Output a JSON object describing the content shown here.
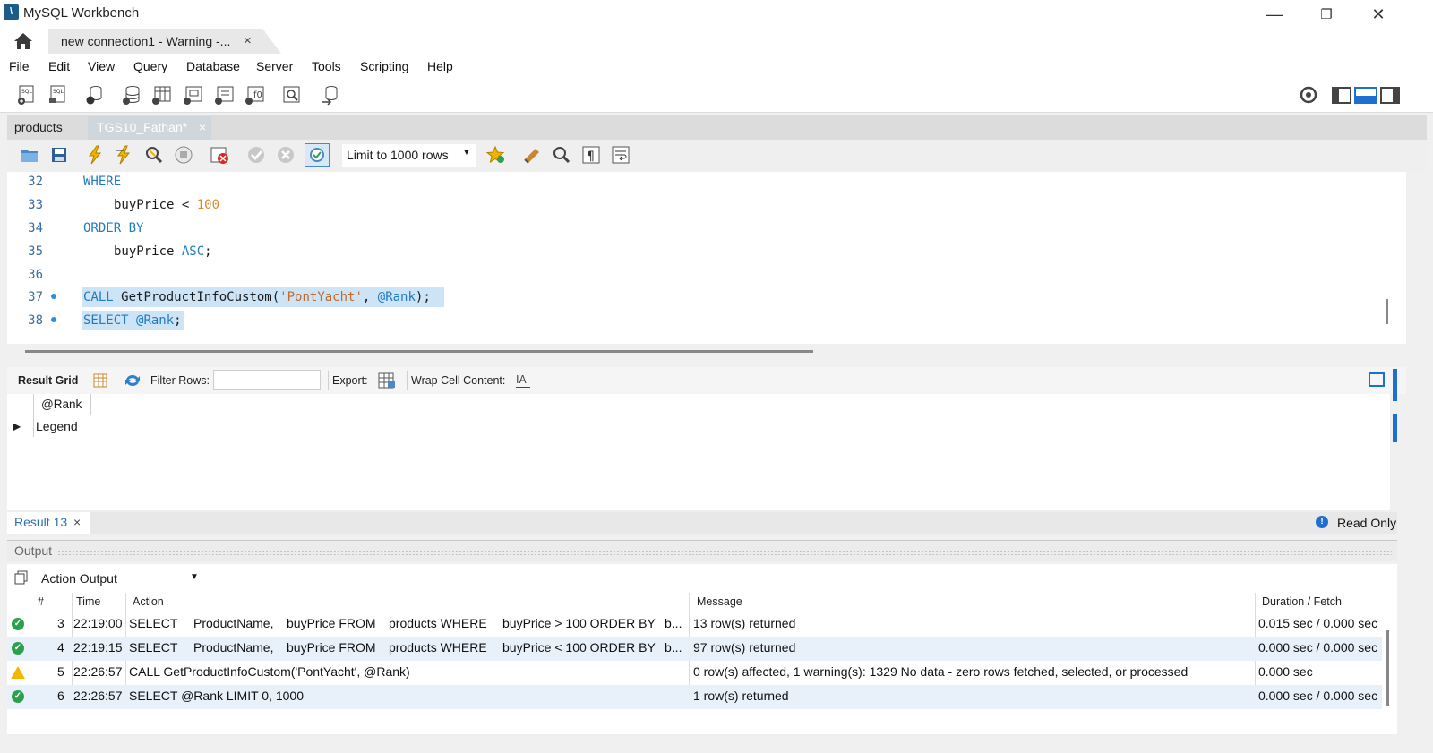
{
  "window": {
    "title": "MySQL Workbench",
    "minimize": "—",
    "restore": "❐",
    "close": "✕"
  },
  "connection_tab": {
    "label": "new connection1 - Warning -...",
    "close": "×"
  },
  "menu": [
    "File",
    "Edit",
    "View",
    "Query",
    "Database",
    "Server",
    "Tools",
    "Scripting",
    "Help"
  ],
  "editor_tabs": [
    {
      "label": "products"
    },
    {
      "label": "TGS10_Fathan*",
      "close": "×"
    }
  ],
  "sql_toolbar": {
    "limit": "Limit to 1000 rows"
  },
  "editor": {
    "lines": [
      {
        "n": "32"
      },
      {
        "n": "33"
      },
      {
        "n": "34"
      },
      {
        "n": "35"
      },
      {
        "n": "36"
      },
      {
        "n": "37"
      },
      {
        "n": "38"
      }
    ],
    "tokens": {
      "where": "WHERE",
      "buyprice": "buyPrice",
      "lt": "<",
      "hundred": "100",
      "orderby": "ORDER BY",
      "asc": "ASC",
      "semi": ";",
      "call": "CALL",
      "proc": "GetProductInfoCustom(",
      "arg": "'PontYacht'",
      "comma": ",",
      "rank": "@Rank",
      "close": ");",
      "select": "SELECT"
    }
  },
  "result_toolbar": {
    "result_grid": "Result Grid",
    "filter_rows": "Filter Rows:",
    "filter_value": "",
    "export": "Export:",
    "wrap": "Wrap Cell Content:"
  },
  "result_grid": {
    "column": "@Rank",
    "cell": "Legend"
  },
  "result_tab": {
    "label": "Result 13",
    "close": "×",
    "read_only": "Read Only"
  },
  "output": {
    "label": "Output",
    "selector": "Action Output",
    "headers": {
      "num": "#",
      "time": "Time",
      "action": "Action",
      "message": "Message",
      "duration": "Duration / Fetch"
    },
    "rows": [
      {
        "status": "ok",
        "num": "3",
        "time": "22:19:00",
        "a1": "SELECT",
        "a2": "ProductName,",
        "a3": "buyPrice FROM",
        "a4": "products WHERE",
        "a5": "buyPrice > 100 ORDER BY",
        "a6": "b...",
        "message": "13 row(s) returned",
        "duration": "0.015 sec / 0.000 sec"
      },
      {
        "status": "ok",
        "num": "4",
        "time": "22:19:15",
        "a1": "SELECT",
        "a2": "ProductName,",
        "a3": "buyPrice FROM",
        "a4": "products WHERE",
        "a5": "buyPrice < 100 ORDER BY",
        "a6": "b...",
        "message": "97 row(s) returned",
        "duration": "0.000 sec / 0.000 sec"
      },
      {
        "status": "warning",
        "num": "5",
        "time": "22:26:57",
        "a1": "CALL GetProductInfoCustom('PontYacht', @Rank)",
        "a2": "",
        "a3": "",
        "a4": "",
        "a5": "",
        "a6": "",
        "message": "0 row(s) affected, 1 warning(s): 1329 No data - zero rows fetched, selected, or processed",
        "duration": "0.000 sec"
      },
      {
        "status": "ok",
        "num": "6",
        "time": "22:26:57",
        "a1": "SELECT @Rank LIMIT 0, 1000",
        "a2": "",
        "a3": "",
        "a4": "",
        "a5": "",
        "a6": "",
        "message": "1 row(s) returned",
        "duration": "0.000 sec / 0.000 sec"
      }
    ]
  },
  "colors": {
    "keyword": "#1f7bc2",
    "number": "#d78a2b",
    "accent": "#1d6fd0",
    "ok": "#2aa14a",
    "warning": "#f2b705"
  }
}
